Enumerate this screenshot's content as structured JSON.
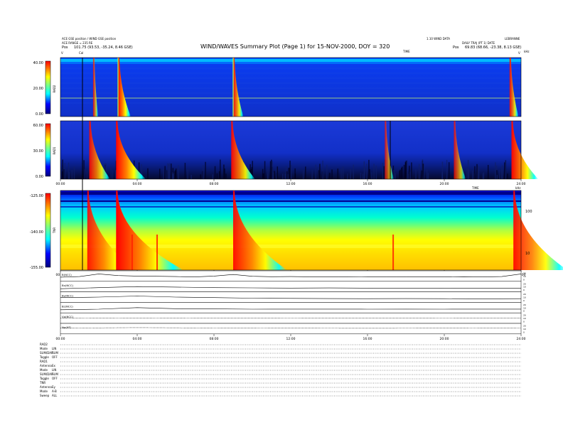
{
  "header": {
    "left_line1": "ACE GSE position / WIND GSE position",
    "left_line2": "ACE RANGE = 235 RE",
    "left_pos_label": "Pos",
    "left_pos_value": "101.75 (93.53, -35.24, 8.46 GSE)",
    "title": "WIND/WAVES Summary Plot (Page 1) for 15-NOV-2000, DOY = 320",
    "right_line1": "1.10 WIND DATA",
    "right_line1b": "LEBRANNE",
    "right_line2": "DAILY TRAJ (PT 1) DATE",
    "right_pos_label": "Pos",
    "right_pos_value": "69.83 (68.66, -23.38, 8.13 GSE)",
    "top_marker_a": "V",
    "top_marker_b": "Cal",
    "top_right_marker": "V",
    "time_label": "TIME",
    "khz_label": "kHz"
  },
  "panels": {
    "rad2": {
      "label": "RAD2",
      "ticks": [
        "40.00",
        "20.00",
        "0.00"
      ]
    },
    "rad1": {
      "label": "RAD1",
      "ticks": [
        "60.00",
        "30.00",
        "0.00"
      ]
    },
    "tnr": {
      "label": "TNR",
      "ticks": [
        "-125.00",
        "-140.00",
        "-155.00"
      ],
      "right_ticks": [
        "100",
        "10"
      ],
      "right_unit": "kHz"
    },
    "time_ticks": [
      "00:00",
      "04:00",
      "08:00",
      "12:00",
      "16:00",
      "20:00",
      "24:00"
    ],
    "time_label_mid": "TIME"
  },
  "chart_data": [
    {
      "type": "heatmap",
      "name_on_chart": "RAD2",
      "x_hours": [
        0,
        24
      ],
      "ylim": [
        0,
        40
      ],
      "events": [
        {
          "hour": 1.7,
          "peak": 0.4
        },
        {
          "hour": 3.0,
          "peak": 1.0
        },
        {
          "hour": 9.0,
          "peak": 0.8
        },
        {
          "hour": 23.4,
          "peak": 0.7
        }
      ]
    },
    {
      "type": "heatmap",
      "name_on_chart": "RAD1",
      "x_hours": [
        0,
        24
      ],
      "ylim": [
        0,
        60
      ],
      "events": [
        {
          "hour": 1.5,
          "peak": 0.7
        },
        {
          "hour": 2.9,
          "peak": 1.0
        },
        {
          "hour": 8.9,
          "peak": 0.8
        },
        {
          "hour": 16.9,
          "peak": 0.3
        },
        {
          "hour": 20.5,
          "peak": 0.4
        },
        {
          "hour": 23.5,
          "peak": 0.9
        }
      ]
    },
    {
      "type": "heatmap",
      "name_on_chart": "TNR",
      "x_hours": [
        0,
        24
      ],
      "ylim": [
        -155,
        -125
      ],
      "events": [
        {
          "hour": 1.4,
          "peak": 0.7
        },
        {
          "hour": 2.9,
          "peak": 1.0
        },
        {
          "hour": 9.0,
          "peak": 0.8
        },
        {
          "hour": 23.6,
          "peak": 0.8
        }
      ]
    },
    {
      "type": "line",
      "traces": [
        {
          "name": "B(NCC)",
          "x": [
            0,
            1,
            2,
            3,
            4,
            5,
            6,
            7,
            8,
            9,
            10,
            11,
            12,
            13,
            14,
            15,
            16,
            17,
            18,
            19,
            20,
            21,
            22,
            23,
            24
          ],
          "y": [
            0.4,
            0.45,
            0.7,
            0.55,
            0.5,
            0.48,
            0.45,
            0.42,
            0.5,
            0.65,
            0.48,
            0.44,
            0.45,
            0.43,
            0.42,
            0.44,
            0.43,
            0.42,
            0.44,
            0.43,
            0.42,
            0.44,
            0.42,
            0.45,
            0.7
          ]
        },
        {
          "name": "Bx(NCC)",
          "x": [
            0,
            2,
            4,
            6,
            8,
            10,
            12,
            14,
            16,
            18,
            20,
            22,
            24
          ],
          "y": [
            0.3,
            0.4,
            0.5,
            0.45,
            0.4,
            0.38,
            0.36,
            0.37,
            0.36,
            0.35,
            0.36,
            0.35,
            0.35
          ]
        },
        {
          "name": "By(NCC)",
          "x": [
            0,
            2,
            4,
            6,
            8,
            10,
            12,
            14,
            16,
            18,
            20,
            22,
            24
          ],
          "y": [
            0.45,
            0.5,
            0.6,
            0.5,
            0.45,
            0.4,
            0.38,
            0.36,
            0.35,
            0.36,
            0.35,
            0.34,
            0.35
          ]
        },
        {
          "name": "Bz(NCC)",
          "x": [
            0,
            2,
            4,
            6,
            8,
            10,
            12,
            14,
            16,
            18,
            20,
            22,
            24
          ],
          "y": [
            0.3,
            0.35,
            0.5,
            0.4,
            0.38,
            0.35,
            0.36,
            0.36,
            0.35,
            0.36,
            0.35,
            0.36,
            0.36
          ]
        },
        {
          "name": "Vp(NCC)",
          "x": [
            0,
            4,
            8,
            12,
            16,
            20,
            24
          ],
          "y": [
            0.5,
            0.52,
            0.5,
            0.51,
            0.5,
            0.51,
            0.5
          ]
        },
        {
          "name": "Np(NT)",
          "x": [
            0,
            4,
            8,
            12,
            16,
            20,
            24
          ],
          "y": [
            0.55,
            0.6,
            0.56,
            0.55,
            0.54,
            0.55,
            0.56
          ]
        }
      ],
      "labels_shown": [
        "B(NCC)",
        "Bx(NCC)",
        "By(NCC)",
        "Bz(NCC)",
        "Vp(NCC)",
        "Np(NT)"
      ],
      "right_ticks": [
        "20",
        "10",
        "0",
        "-10"
      ]
    }
  ],
  "footer": {
    "rad2_header": "RAD2",
    "rad2_rows": [
      {
        "k": "Mode",
        "v": "LIN"
      },
      {
        "k": "SUM/DAP",
        "v": "SUM"
      },
      {
        "k": "Toggle",
        "v": "OFF"
      }
    ],
    "rad1_header": "RAD1",
    "rad1_rows": [
      {
        "k": "Antenna",
        "v": "Ex"
      },
      {
        "k": "Mode",
        "v": "LIN"
      },
      {
        "k": "SUM/DAP",
        "v": "SUM"
      },
      {
        "k": "Toggle",
        "v": "OFF"
      }
    ],
    "tnr_header": "TNR",
    "tnr_rows": [
      {
        "k": "Antenna",
        "v": "Ey"
      },
      {
        "k": "Mode",
        "v": "A-B"
      },
      {
        "k": "Sweep",
        "v": "ALL"
      }
    ]
  }
}
